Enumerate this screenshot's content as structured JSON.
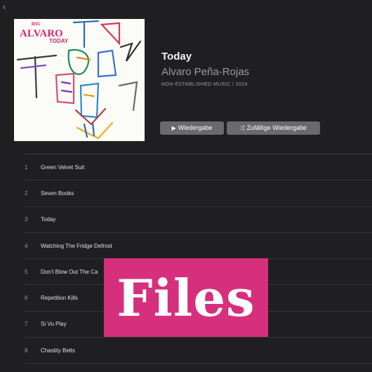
{
  "nav": {
    "back_glyph": "‹",
    "back_icon": "chevron-left-icon"
  },
  "album": {
    "cover": {
      "badge": "BSC",
      "artist_line": "ALVARO",
      "title_line": "TODAY"
    },
    "title": "Today",
    "artist": "Alvaro Peña-Rojas",
    "meta": "NON-ESTABLISHED MUSIC / 2024"
  },
  "actions": {
    "play_label": "Wiedergabe",
    "play_icon": "play-icon",
    "shuffle_label": "Zufällige Wiedergabe",
    "shuffle_icon": "shuffle-icon"
  },
  "tracks": [
    {
      "num": "1",
      "title": "Green Velvet Suit"
    },
    {
      "num": "2",
      "title": "Seven Books"
    },
    {
      "num": "3",
      "title": "Today"
    },
    {
      "num": "4",
      "title": "Watching The Fridge Defrost"
    },
    {
      "num": "5",
      "title": "Don't Blow Out The Ca"
    },
    {
      "num": "6",
      "title": "Repetition Kills"
    },
    {
      "num": "7",
      "title": "Si Vu Play"
    },
    {
      "num": "8",
      "title": "Chastity Belts"
    }
  ],
  "overlay": {
    "text": "Files",
    "color": "#d6307c"
  },
  "colors": {
    "background": "#1f1f21",
    "button": "#6a6a6c"
  }
}
